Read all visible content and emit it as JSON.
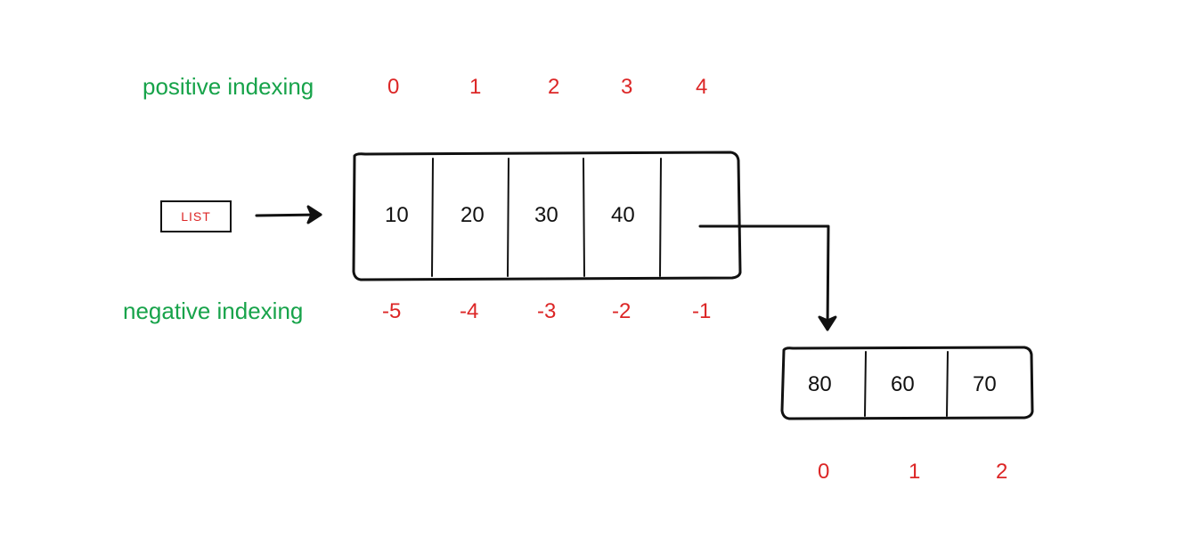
{
  "labels": {
    "positive": "positive indexing",
    "negative": "negative indexing",
    "list": "LIST"
  },
  "mainList": {
    "positiveIndexes": [
      "0",
      "1",
      "2",
      "3",
      "4"
    ],
    "values": [
      "10",
      "20",
      "30",
      "40",
      ""
    ],
    "negativeIndexes": [
      "-5",
      "-4",
      "-3",
      "-2",
      "-1"
    ]
  },
  "nestedList": {
    "values": [
      "80",
      "60",
      "70"
    ],
    "indexes": [
      "0",
      "1",
      "2"
    ]
  }
}
